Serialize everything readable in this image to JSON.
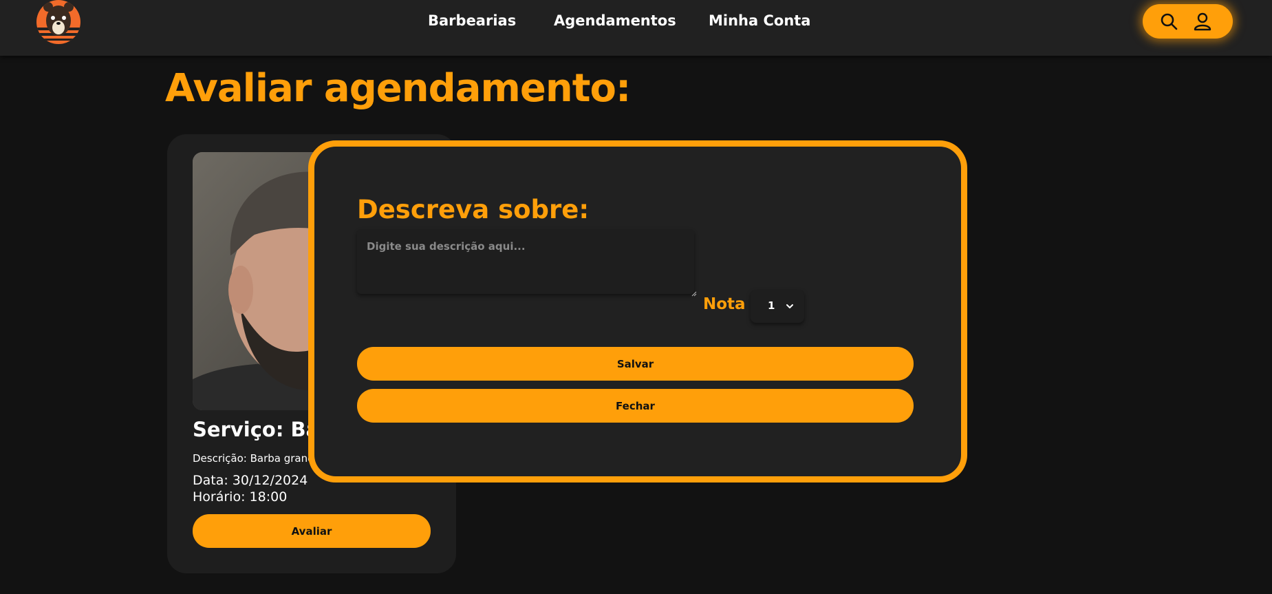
{
  "nav": {
    "links": [
      "Barbearias",
      "Agendamentos",
      "Minha Conta"
    ]
  },
  "header_icons": {
    "search": "search-icon",
    "user": "user-icon",
    "logo": "bear-logo"
  },
  "page": {
    "title": "Avaliar agendamento:"
  },
  "card": {
    "service_title": "Serviço: Barb",
    "description": "Descrição: Barba grande",
    "date": "Data: 30/12/2024",
    "time": "Horário: 18:00",
    "button": "Avaliar"
  },
  "modal": {
    "title": "Descreva sobre:",
    "placeholder": "Digite sua descrição aqui...",
    "nota_label": "Nota",
    "nota_value": "1",
    "save_label": "Salvar",
    "close_label": "Fechar"
  },
  "colors": {
    "accent": "#ff9f0a",
    "background": "#121212",
    "surface": "#212121"
  }
}
